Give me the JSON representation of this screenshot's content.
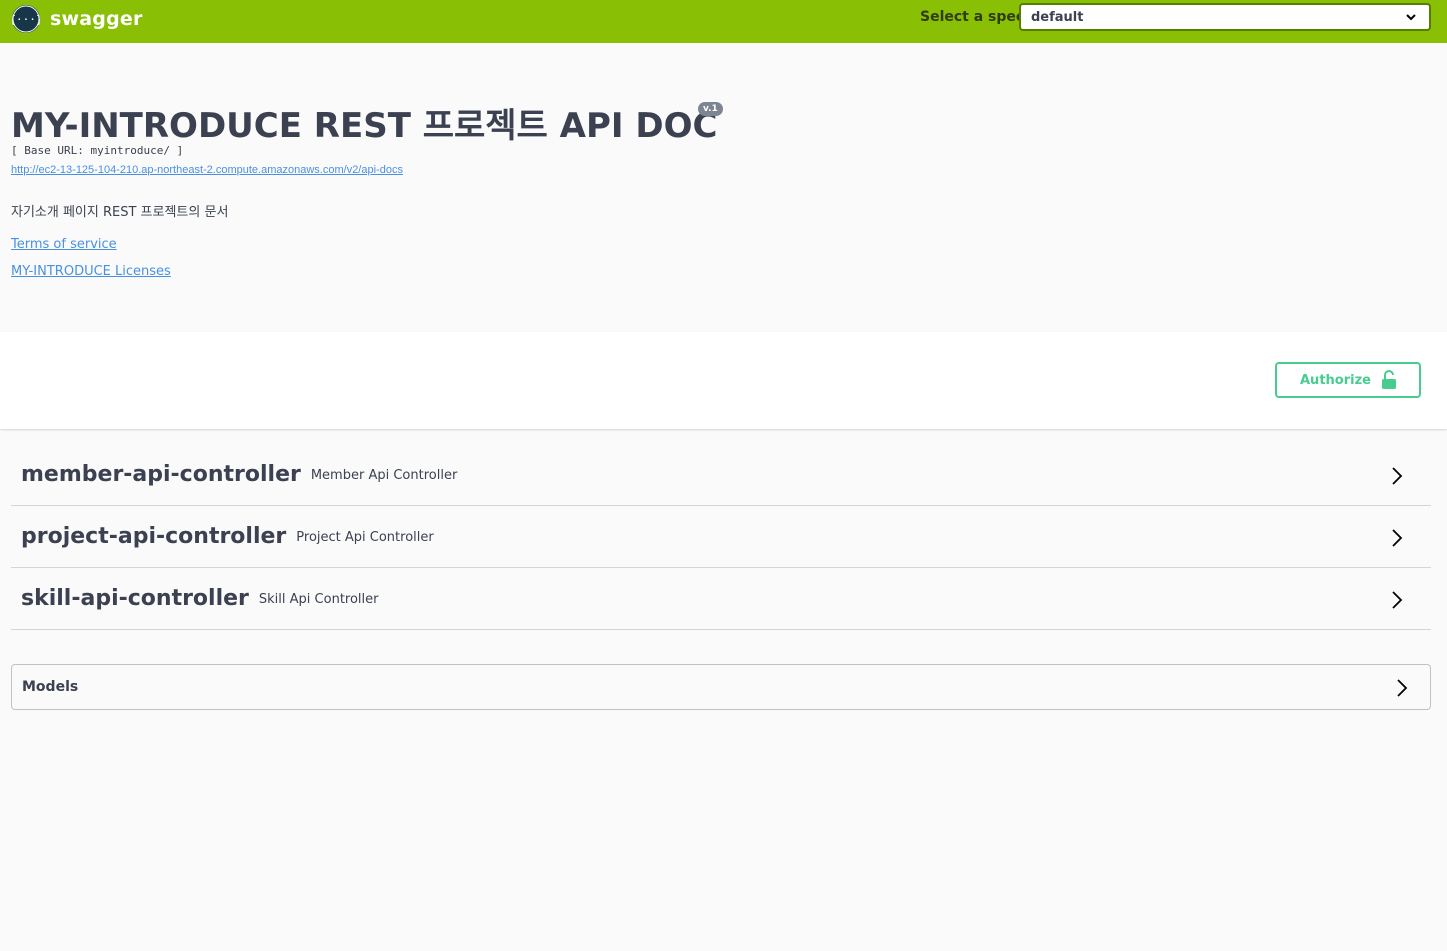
{
  "topbar": {
    "brand": "swagger",
    "spec_label": "Select a spec",
    "spec_value": "default"
  },
  "info": {
    "title": "MY-INTRODUCE REST 프로젝트 API DOC",
    "version": "v.1",
    "base_url": "[ Base URL: myintroduce/ ]",
    "spec_url": "http://ec2-13-125-104-210.ap-northeast-2.compute.amazonaws.com/v2/api-docs",
    "description": "자기소개 페이지 REST 프로젝트의 문서",
    "terms_label": "Terms of service",
    "license_label": "MY-INTRODUCE Licenses"
  },
  "scheme": {
    "authorize_label": "Authorize"
  },
  "tags": [
    {
      "name": "member-api-controller",
      "description": "Member Api Controller"
    },
    {
      "name": "project-api-controller",
      "description": "Project Api Controller"
    },
    {
      "name": "skill-api-controller",
      "description": "Skill Api Controller"
    }
  ],
  "models": {
    "title": "Models"
  },
  "colors": {
    "topbar_bg": "#89bf04",
    "authorize": "#49cc90",
    "link": "#4990e2"
  },
  "icons": {
    "logo": "swagger-logo-icon",
    "select_chevron": "chevron-down-icon",
    "authorize_lock": "unlock-icon",
    "expand": "chevron-right-icon"
  }
}
